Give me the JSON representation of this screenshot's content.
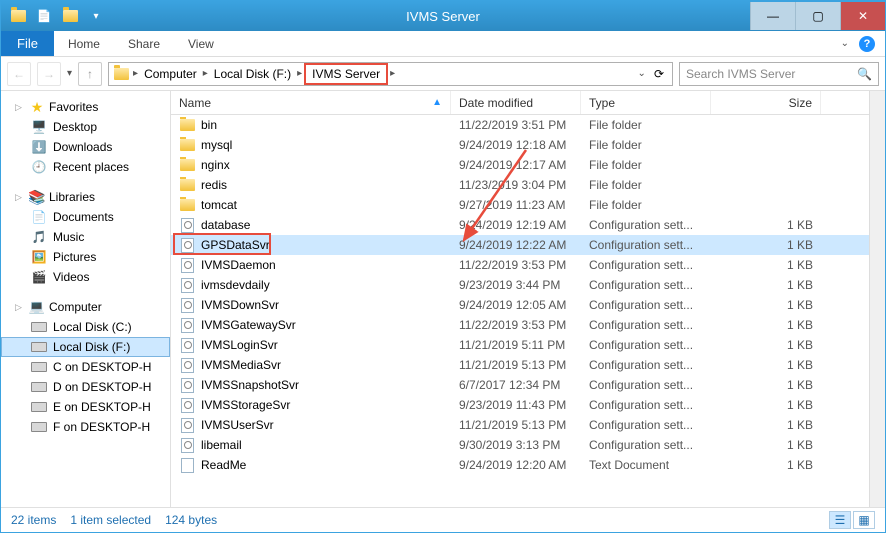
{
  "window": {
    "title": "IVMS Server"
  },
  "menu": {
    "file": "File",
    "home": "Home",
    "share": "Share",
    "view": "View"
  },
  "breadcrumbs": [
    "Computer",
    "Local Disk (F:)",
    "IVMS Server"
  ],
  "search": {
    "placeholder": "Search IVMS Server"
  },
  "sidebar": {
    "favorites": {
      "label": "Favorites",
      "items": [
        "Desktop",
        "Downloads",
        "Recent places"
      ]
    },
    "libraries": {
      "label": "Libraries",
      "items": [
        "Documents",
        "Music",
        "Pictures",
        "Videos"
      ]
    },
    "computer": {
      "label": "Computer",
      "items": [
        "Local Disk (C:)",
        "Local Disk (F:)",
        "C on DESKTOP-H",
        "D on DESKTOP-H",
        "E on DESKTOP-H",
        "F on DESKTOP-H"
      ]
    }
  },
  "columns": {
    "name": "Name",
    "date": "Date modified",
    "type": "Type",
    "size": "Size"
  },
  "files": [
    {
      "name": "bin",
      "date": "11/22/2019 3:51 PM",
      "type": "File folder",
      "size": "",
      "kind": "folder"
    },
    {
      "name": "mysql",
      "date": "9/24/2019 12:18 AM",
      "type": "File folder",
      "size": "",
      "kind": "folder"
    },
    {
      "name": "nginx",
      "date": "9/24/2019 12:17 AM",
      "type": "File folder",
      "size": "",
      "kind": "folder"
    },
    {
      "name": "redis",
      "date": "11/23/2019 3:04 PM",
      "type": "File folder",
      "size": "",
      "kind": "folder"
    },
    {
      "name": "tomcat",
      "date": "9/27/2019 11:23 AM",
      "type": "File folder",
      "size": "",
      "kind": "folder"
    },
    {
      "name": "database",
      "date": "9/24/2019 12:19 AM",
      "type": "Configuration sett...",
      "size": "1 KB",
      "kind": "cfg"
    },
    {
      "name": "GPSDataSvr",
      "date": "9/24/2019 12:22 AM",
      "type": "Configuration sett...",
      "size": "1 KB",
      "kind": "cfg",
      "selected": true,
      "highlight": true
    },
    {
      "name": "IVMSDaemon",
      "date": "11/22/2019 3:53 PM",
      "type": "Configuration sett...",
      "size": "1 KB",
      "kind": "cfg"
    },
    {
      "name": "ivmsdevdaily",
      "date": "9/23/2019 3:44 PM",
      "type": "Configuration sett...",
      "size": "1 KB",
      "kind": "cfg"
    },
    {
      "name": "IVMSDownSvr",
      "date": "9/24/2019 12:05 AM",
      "type": "Configuration sett...",
      "size": "1 KB",
      "kind": "cfg"
    },
    {
      "name": "IVMSGatewaySvr",
      "date": "11/22/2019 3:53 PM",
      "type": "Configuration sett...",
      "size": "1 KB",
      "kind": "cfg"
    },
    {
      "name": "IVMSLoginSvr",
      "date": "11/21/2019 5:11 PM",
      "type": "Configuration sett...",
      "size": "1 KB",
      "kind": "cfg"
    },
    {
      "name": "IVMSMediaSvr",
      "date": "11/21/2019 5:13 PM",
      "type": "Configuration sett...",
      "size": "1 KB",
      "kind": "cfg"
    },
    {
      "name": "IVMSSnapshotSvr",
      "date": "6/7/2017 12:34 PM",
      "type": "Configuration sett...",
      "size": "1 KB",
      "kind": "cfg"
    },
    {
      "name": "IVMSStorageSvr",
      "date": "9/23/2019 11:43 PM",
      "type": "Configuration sett...",
      "size": "1 KB",
      "kind": "cfg"
    },
    {
      "name": "IVMSUserSvr",
      "date": "11/21/2019 5:13 PM",
      "type": "Configuration sett...",
      "size": "1 KB",
      "kind": "cfg"
    },
    {
      "name": "libemail",
      "date": "9/30/2019 3:13 PM",
      "type": "Configuration sett...",
      "size": "1 KB",
      "kind": "cfg"
    },
    {
      "name": "ReadMe",
      "date": "9/24/2019 12:20 AM",
      "type": "Text Document",
      "size": "1 KB",
      "kind": "txt"
    }
  ],
  "status": {
    "count": "22 items",
    "selection": "1 item selected",
    "bytes": "124 bytes"
  }
}
